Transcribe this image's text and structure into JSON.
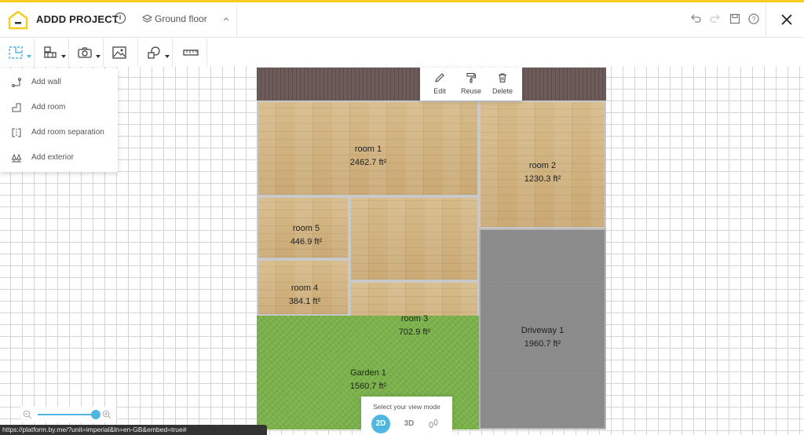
{
  "header": {
    "project_title": "ADDD PROJECT",
    "floor": "Ground floor",
    "icons": [
      "logo-house-icon",
      "info-icon",
      "layers-icon",
      "chevron-up-icon",
      "undo-icon",
      "redo-icon",
      "save-icon",
      "help-icon",
      "close-icon"
    ]
  },
  "toolbar": {
    "tools": [
      "construct-tool",
      "furniture-tool",
      "camera-tool",
      "image-tool",
      "shapes-tool",
      "measure-tool"
    ]
  },
  "dropdown": {
    "items": [
      {
        "label": "Add wall",
        "icon": "wall-icon"
      },
      {
        "label": "Add room",
        "icon": "room-icon"
      },
      {
        "label": "Add room separation",
        "icon": "separation-icon"
      },
      {
        "label": "Add exterior",
        "icon": "exterior-icon"
      }
    ]
  },
  "context_menu": {
    "items": [
      {
        "label": "Edit",
        "icon": "pencil-icon"
      },
      {
        "label": "Reuse",
        "icon": "paint-roller-icon"
      },
      {
        "label": "Delete",
        "icon": "trash-icon"
      }
    ]
  },
  "rooms": [
    {
      "name": "room 1",
      "area": "2462.7 ft²"
    },
    {
      "name": "room 2",
      "area": "1230.3 ft²"
    },
    {
      "name": "room 5",
      "area": "446.9 ft²"
    },
    {
      "name": "room 4",
      "area": "384.1 ft²"
    },
    {
      "name": "room 3",
      "area": "702.9 ft²"
    },
    {
      "name": "Driveway 1",
      "area": "1960.7 ft²"
    },
    {
      "name": "Garden 1",
      "area": "1560.7 ft²"
    }
  ],
  "view_mode": {
    "title": "Select your view mode",
    "option_2d": "2D",
    "option_3d": "3D",
    "active": "2D"
  },
  "zoom": {
    "level": 0.95
  },
  "status_bar": {
    "url": "https://platform.by.me/?unit=imperial&ln=en-GB&embed=true#"
  },
  "colors": {
    "accent": "#f5cd1e",
    "primary_blue": "#4fb6e0",
    "grid_line": "#d4d4d4"
  }
}
